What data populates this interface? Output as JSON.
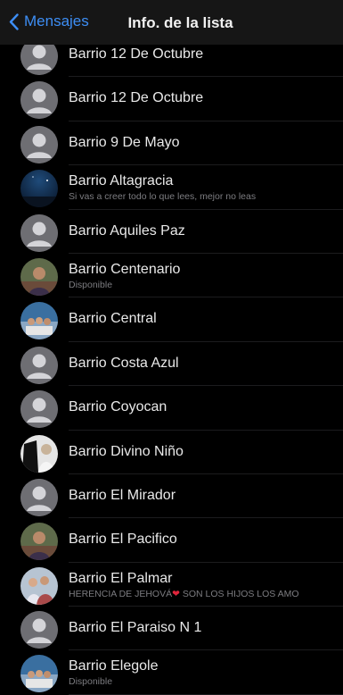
{
  "navbar": {
    "back_label": "Mensajes",
    "title": "Info. de la lista"
  },
  "colors": {
    "accent": "#3d8ef5",
    "background": "#000000",
    "secondary_text": "#7c7c80",
    "heart": "#e0243b"
  },
  "contacts": [
    {
      "name": "Barrio 12 De Octubre",
      "status": "",
      "avatar": "default-avatar"
    },
    {
      "name": "Barrio 12 De Octubre",
      "status": "",
      "avatar": "default-avatar"
    },
    {
      "name": "Barrio 9 De Mayo",
      "status": "",
      "avatar": "default-avatar"
    },
    {
      "name": "Barrio Altagracia",
      "status": "Si vas a creer todo lo que lees, mejor no leas",
      "avatar": "night-sky-photo"
    },
    {
      "name": "Barrio Aquiles Paz",
      "status": "",
      "avatar": "default-avatar"
    },
    {
      "name": "Barrio Centenario",
      "status": "Disponible",
      "avatar": "person-photo"
    },
    {
      "name": "Barrio Central",
      "status": "",
      "avatar": "group-photo"
    },
    {
      "name": "Barrio Costa Azul",
      "status": "",
      "avatar": "default-avatar"
    },
    {
      "name": "Barrio Coyocan",
      "status": "",
      "avatar": "default-avatar"
    },
    {
      "name": "Barrio Divino Niño",
      "status": "",
      "avatar": "black-white-photo"
    },
    {
      "name": "Barrio El Mirador",
      "status": "",
      "avatar": "default-avatar"
    },
    {
      "name": "Barrio El Pacifico",
      "status": "",
      "avatar": "person-photo"
    },
    {
      "name": "Barrio El Palmar",
      "status": "HERENCIA DE JEHOVÁ",
      "status_suffix": " SON LOS HIJOS LOS AMO",
      "avatar": "family-photo"
    },
    {
      "name": "Barrio El Paraiso N 1",
      "status": "",
      "avatar": "default-avatar"
    },
    {
      "name": "Barrio Elegole",
      "status": "Disponible",
      "avatar": "group-photo"
    }
  ]
}
